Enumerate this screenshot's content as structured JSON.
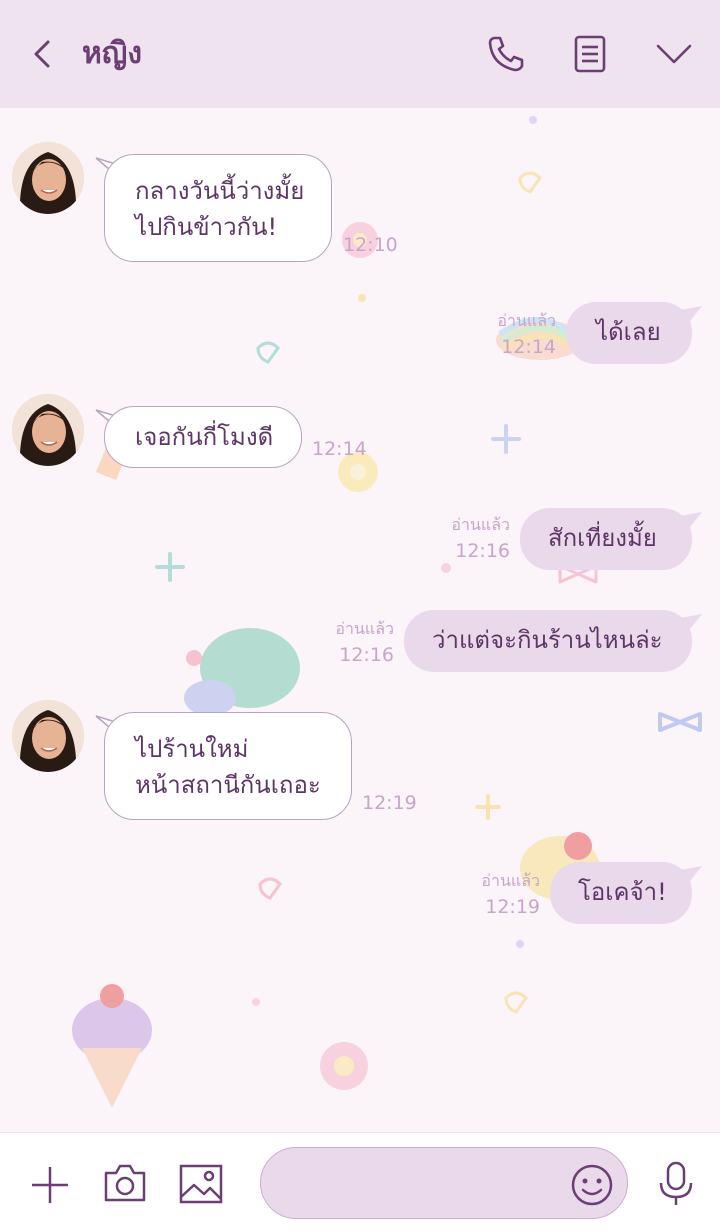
{
  "header": {
    "contact_name": "หญิง",
    "icons": [
      "back-chevron-icon",
      "phone-icon",
      "notes-icon",
      "chevron-down-icon"
    ]
  },
  "messages": [
    {
      "side": "in",
      "lines": [
        "กลางวันนี้ว่างมั้ย",
        "ไปกินข้าวกัน!"
      ],
      "time": "12:10"
    },
    {
      "side": "out",
      "text": "ได้เลย",
      "read": "อ่านแล้ว",
      "time": "12:14"
    },
    {
      "side": "in",
      "lines": [
        "เจอกันกี่โมงดี"
      ],
      "time": "12:14"
    },
    {
      "side": "out",
      "text": "สักเที่ยงมั้ย",
      "read": "อ่านแล้ว",
      "time": "12:16"
    },
    {
      "side": "out",
      "text": "ว่าแต่จะกินร้านไหนล่ะ",
      "read": "อ่านแล้ว",
      "time": "12:16"
    },
    {
      "side": "in",
      "lines": [
        "ไปร้านใหม่",
        "หน้าสถานีกันเถอะ"
      ],
      "time": "12:19"
    },
    {
      "side": "out",
      "text": "โอเคจ้า!",
      "read": "อ่านแล้ว",
      "time": "12:19"
    }
  ],
  "footer": {
    "icons": [
      "plus-icon",
      "camera-icon",
      "image-icon",
      "emoji-icon",
      "microphone-icon"
    ],
    "input_value": ""
  },
  "colors": {
    "header_bg": "#efe3f0",
    "accent": "#6b3f72",
    "bubble_out": "#ead9eb",
    "bubble_in": "#ffffff",
    "meta_text": "#c8a6cc",
    "chat_bg": "#fbf4f9"
  }
}
